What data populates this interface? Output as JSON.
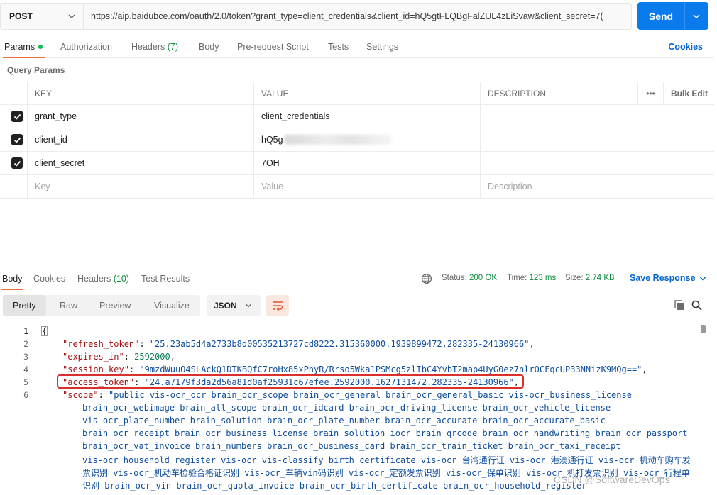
{
  "request": {
    "method": "POST",
    "url": "https://aip.baidubce.com/oauth/2.0/token?grant_type=client_credentials&client_id=hQ5gtFLQBgFalZUL4zLiSvaw&client_secret=7(",
    "send_label": "Send"
  },
  "request_tabs": [
    {
      "label": "Params",
      "count": ""
    },
    {
      "label": "Authorization",
      "count": ""
    },
    {
      "label": "Headers",
      "count": "(7)"
    },
    {
      "label": "Body",
      "count": ""
    },
    {
      "label": "Pre-request Script",
      "count": ""
    },
    {
      "label": "Tests",
      "count": ""
    },
    {
      "label": "Settings",
      "count": ""
    }
  ],
  "cookies_label": "Cookies",
  "query_params": {
    "title": "Query Params",
    "headers": {
      "key": "KEY",
      "value": "VALUE",
      "description": "DESCRIPTION",
      "more": "•••",
      "bulk_edit": "Bulk Edit"
    },
    "rows": [
      {
        "key": "grant_type",
        "value": "client_credentials",
        "checked": true
      },
      {
        "key": "client_id",
        "value": "hQ5g",
        "checked": true
      },
      {
        "key": "client_secret",
        "value": "7OH",
        "checked": true
      }
    ],
    "placeholder": {
      "key": "Key",
      "value": "Value",
      "description": "Description"
    }
  },
  "response_tabs": [
    {
      "label": "Body",
      "count": ""
    },
    {
      "label": "Cookies",
      "count": ""
    },
    {
      "label": "Headers",
      "count": "(10)"
    },
    {
      "label": "Test Results",
      "count": ""
    }
  ],
  "response_status": {
    "status_label": "Status:",
    "status_value": "200 OK",
    "time_label": "Time:",
    "time_value": "123 ms",
    "size_label": "Size:",
    "size_value": "2.74 KB"
  },
  "save_response_label": "Save Response",
  "view_modes": [
    "Pretty",
    "Raw",
    "Preview",
    "Visualize"
  ],
  "format": "JSON",
  "code": {
    "line_numbers": [
      "1",
      "2",
      "3",
      "4",
      "5",
      "6"
    ],
    "open_brace": "{",
    "refresh_token_key": "\"refresh_token\"",
    "refresh_token_value": "\"25.23ab5d4a2733b8d00535213727cd8222.315360000.1939899472.282335-24130966\"",
    "expires_in_key": "\"expires_in\"",
    "expires_in_value": "2592000",
    "session_key_key": "\"session_key\"",
    "session_key_value": "\"9mzdWuuO4SLAckQ1DTKBQfC7roHx85xPhyR/Rrso5Wka1PSMcg5zlIbC4YvbT2map4UyG0ez7nlrOCFqcUP33NNizK9MQg==\"",
    "access_token_key": "\"access_token\"",
    "access_token_value": "\"24.a7179f3da2d56a81d0af25931c67efee.2592000.1627131472.282335-24130966\"",
    "scope_key": "\"scope\"",
    "scope_lines": [
      "\"public vis-ocr_ocr brain_ocr_scope brain_ocr_general brain_ocr_general_basic vis-ocr_business_license",
      "brain_ocr_webimage brain_all_scope brain_ocr_idcard brain_ocr_driving_license brain_ocr_vehicle_license",
      "vis-ocr_plate_number brain_solution brain_ocr_plate_number brain_ocr_accurate brain_ocr_accurate_basic",
      "brain_ocr_receipt brain_ocr_business_license brain_solution_iocr brain_qrcode brain_ocr_handwriting brain_ocr_passport",
      "brain_ocr_vat_invoice brain_numbers brain_ocr_business_card brain_ocr_train_ticket brain_ocr_taxi_receipt",
      "vis-ocr_household_register vis-ocr_vis-classify_birth_certificate vis-ocr_台湾通行证 vis-ocr_港澳通行证 vis-ocr_机动车购车发",
      "票识别 vis-ocr_机动车检验合格证识别 vis-ocr_车辆vin码识别 vis-ocr_定额发票识别 vis-ocr_保单识别 vis-ocr_机打发票识别 vis-ocr_行程单",
      "识别 brain_ocr_vin brain_ocr_quota_invoice brain_ocr_birth_certificate brain_ocr_household_register"
    ]
  },
  "watermark": "CSDN @SoftwareDevOps"
}
